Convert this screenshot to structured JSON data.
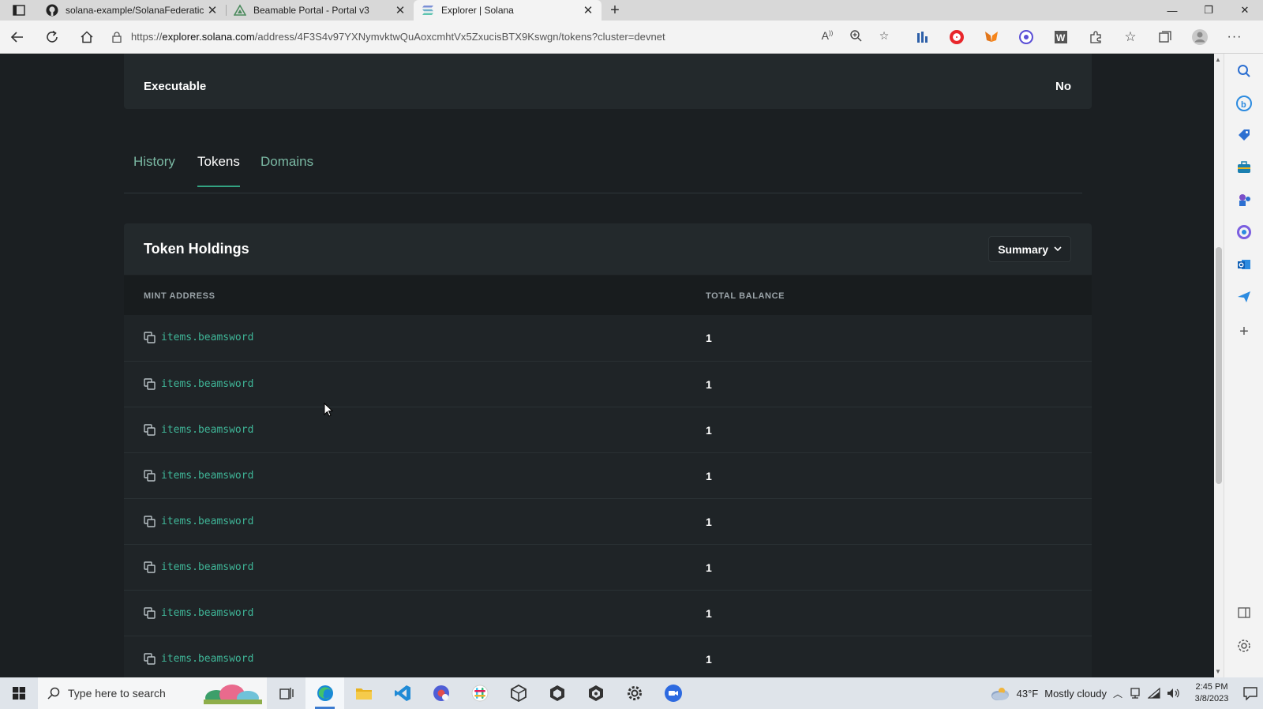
{
  "browser": {
    "tabs": [
      {
        "title": "solana-example/SolanaFederatic",
        "icon": "github-icon",
        "active": false
      },
      {
        "title": "Beamable Portal - Portal v3",
        "icon": "beamable-icon",
        "active": false
      },
      {
        "title": "Explorer | Solana",
        "icon": "solana-icon",
        "active": true
      }
    ],
    "url_prefix": "https://",
    "url_domain": "explorer.solana.com",
    "url_path": "/address/4F3S4v97YXNymvktwQuAoxcmhtVx5ZxucisBTX9Kswgn/tokens?cluster=devnet"
  },
  "account": {
    "executable_label": "Executable",
    "executable_value": "No"
  },
  "tabs": {
    "history": "History",
    "tokens": "Tokens",
    "domains": "Domains",
    "active": "Tokens"
  },
  "token_holdings": {
    "title": "Token Holdings",
    "view_selector": "Summary",
    "columns": {
      "mint": "MINT ADDRESS",
      "balance": "TOTAL BALANCE"
    },
    "rows": [
      {
        "mint": "items.beamsword",
        "balance": "1"
      },
      {
        "mint": "items.beamsword",
        "balance": "1"
      },
      {
        "mint": "items.beamsword",
        "balance": "1"
      },
      {
        "mint": "items.beamsword",
        "balance": "1"
      },
      {
        "mint": "items.beamsword",
        "balance": "1"
      },
      {
        "mint": "items.beamsword",
        "balance": "1"
      },
      {
        "mint": "items.beamsword",
        "balance": "1"
      },
      {
        "mint": "items.beamsword",
        "balance": "1"
      }
    ]
  },
  "taskbar": {
    "search_placeholder": "Type here to search",
    "weather_temp": "43°F",
    "weather_desc": "Mostly cloudy",
    "time": "2:45 PM",
    "date": "3/8/2023"
  },
  "colors": {
    "page_bg": "#1b1f22",
    "card_bg": "#23292c",
    "accent_green": "#3fb597",
    "tab_link": "#7ab8a3"
  }
}
